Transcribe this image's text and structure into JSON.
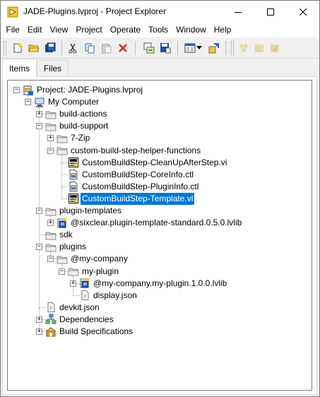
{
  "window": {
    "title": "JADE-Plugins.lvproj - Project Explorer",
    "controls": {
      "minimize": "minimize",
      "maximize": "maximize",
      "close": "close"
    }
  },
  "menu": [
    "File",
    "Edit",
    "View",
    "Project",
    "Operate",
    "Tools",
    "Window",
    "Help"
  ],
  "toolbar": [
    "new-icon",
    "open-icon",
    "save-all-icon",
    "cut-icon",
    "copy-icon",
    "paste-icon",
    "delete-icon",
    "build-icon",
    "save-icon",
    "view-icon",
    "dropdown-icon",
    "properties-icon",
    "source-control-icons"
  ],
  "tabs": [
    {
      "label": "Items",
      "active": true
    },
    {
      "label": "Files",
      "active": false
    }
  ],
  "tree": [
    {
      "label": "Project: JADE-Plugins.lvproj",
      "icon": "project-icon",
      "expanded": true
    },
    {
      "label": "My Computer",
      "icon": "computer-icon",
      "expanded": true
    },
    {
      "label": "build-actions",
      "icon": "folder-icon",
      "expanded": false
    },
    {
      "label": "build-support",
      "icon": "folder-icon",
      "expanded": true
    },
    {
      "label": "7-Zip",
      "icon": "folder-icon",
      "expanded": false
    },
    {
      "label": "custom-build-step-helper-functions",
      "icon": "folder-icon",
      "expanded": true
    },
    {
      "label": "CustomBuildStep-CleanUpAfterStep.vi",
      "icon": "vi-icon"
    },
    {
      "label": "CustomBuildStep-CoreInfo.ctl",
      "icon": "ctl-icon"
    },
    {
      "label": "CustomBuildStep-PluginInfo.ctl",
      "icon": "ctl-icon"
    },
    {
      "label": "CustomBuildStep-Template.vi",
      "icon": "vi-icon",
      "selected": true
    },
    {
      "label": "plugin-templates",
      "icon": "folder-icon",
      "expanded": true
    },
    {
      "label": "@sixclear.plugin-template-standard.0.5.0.lvlib",
      "icon": "library-icon",
      "expanded": false
    },
    {
      "label": "sdk",
      "icon": "folder-icon"
    },
    {
      "label": "plugins",
      "icon": "folder-icon",
      "expanded": true
    },
    {
      "label": "@my-company",
      "icon": "folder-icon",
      "expanded": true
    },
    {
      "label": "my-plugin",
      "icon": "folder-icon",
      "expanded": true
    },
    {
      "label": "@my-company.my-plugin.1.0.0.lvlib",
      "icon": "library-icon",
      "expanded": false
    },
    {
      "label": "display.json",
      "icon": "file-icon"
    },
    {
      "label": "devkit.json",
      "icon": "file-icon"
    },
    {
      "label": "Dependencies",
      "icon": "dependencies-icon",
      "expanded": false
    },
    {
      "label": "Build Specifications",
      "icon": "build-spec-icon",
      "expanded": false
    }
  ],
  "colors": {
    "selection": "#0078d7",
    "folder": "#e8c15a"
  }
}
